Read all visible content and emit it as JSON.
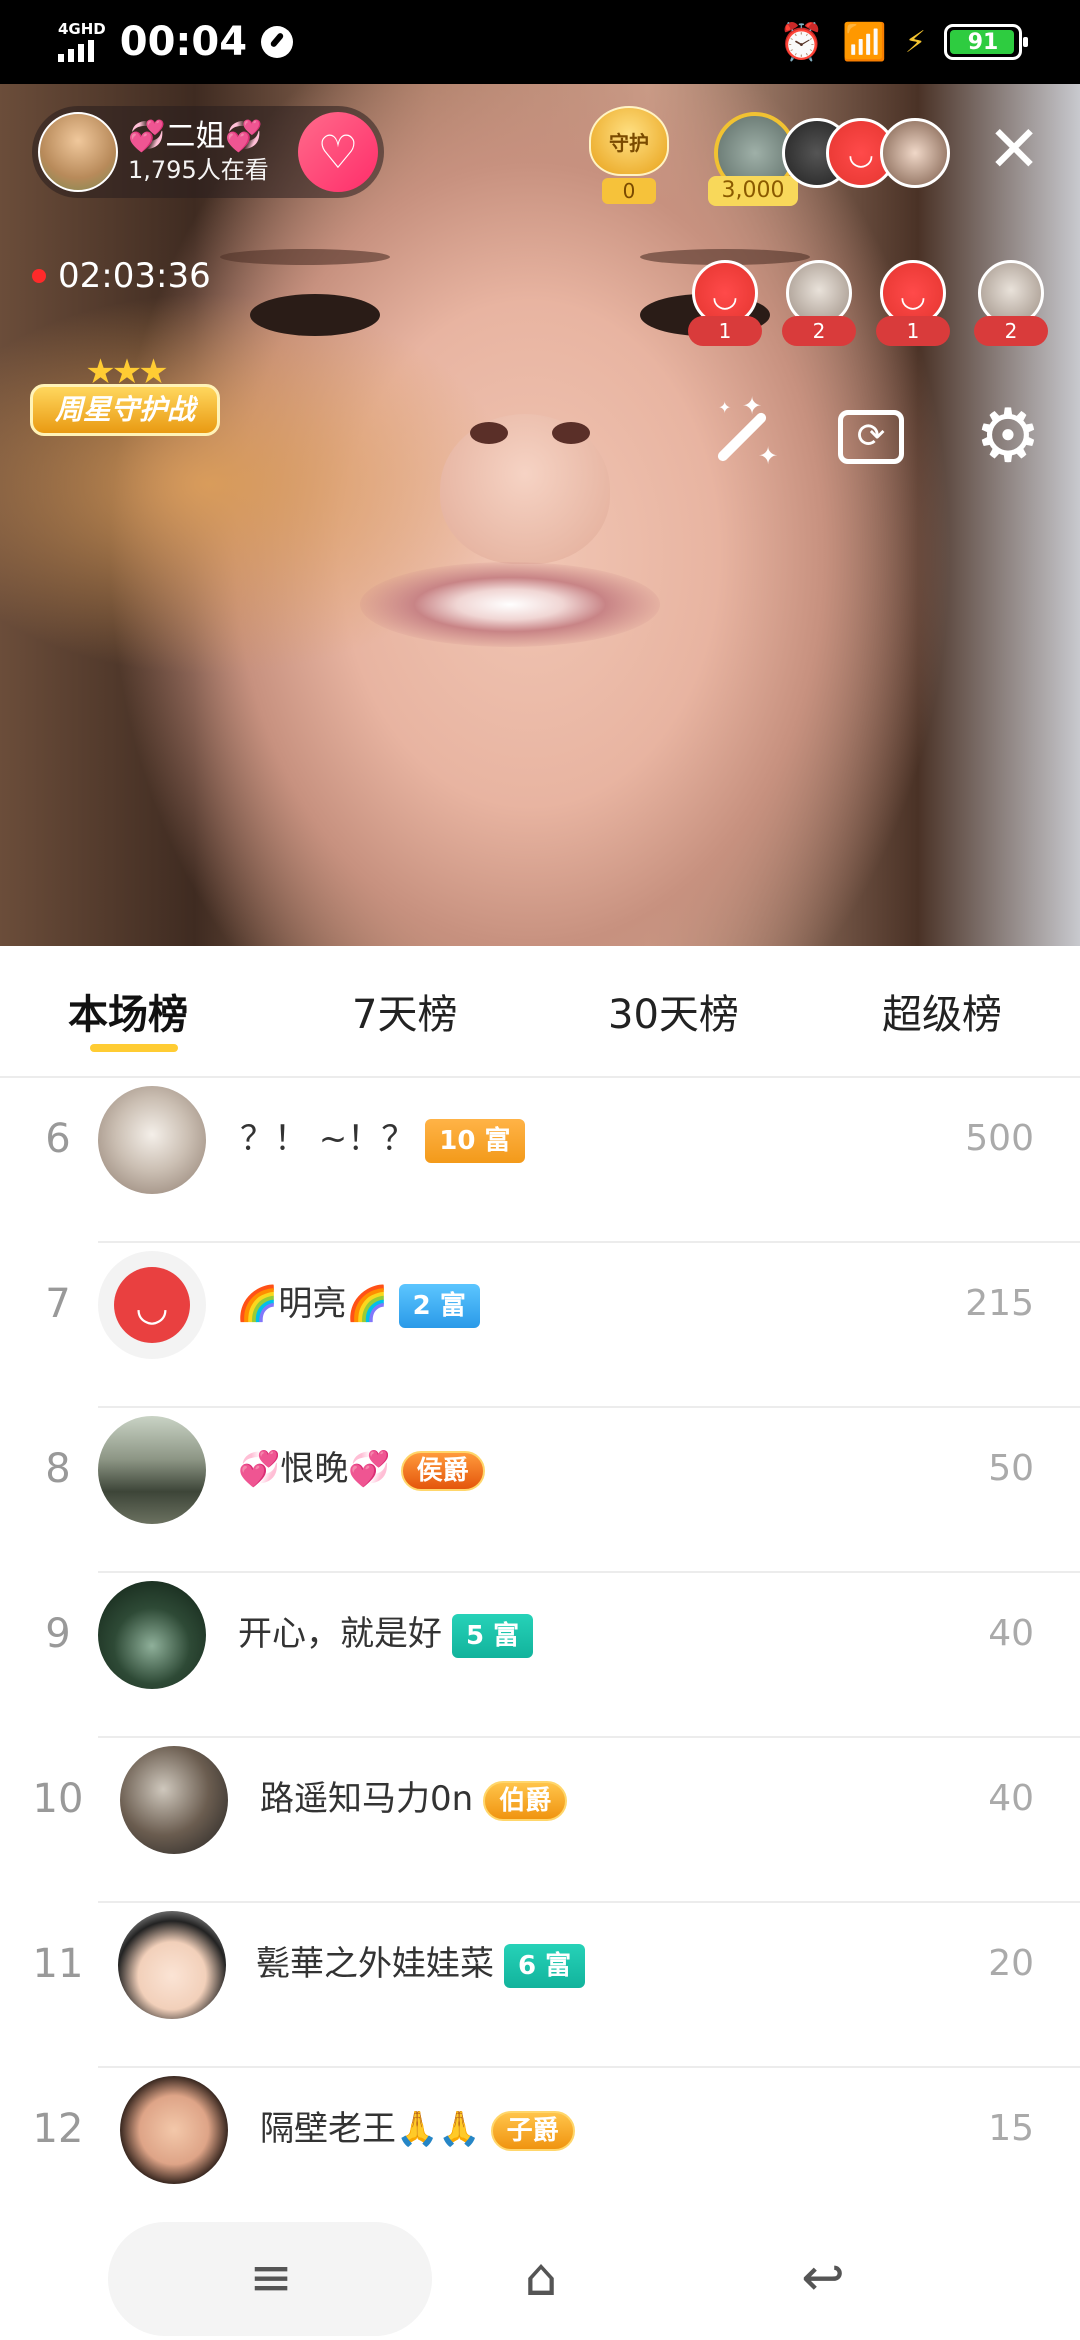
{
  "status_bar": {
    "network": "4GHD",
    "time": "00:04",
    "battery": "91",
    "icons": [
      "signal-icon",
      "compass-icon",
      "alarm-icon",
      "wifi-icon",
      "charging-icon",
      "battery-icon"
    ]
  },
  "live": {
    "host_name": "💞二姐💞",
    "viewers": "1,795人在看",
    "follow_icon": "heart-plus-icon",
    "guard_label": "守护",
    "guard_count": "0",
    "top_fan_value": "3,000",
    "timer": "02:03:36",
    "weekstar_label": "周星守护战",
    "gift_counts": [
      "1",
      "2",
      "1",
      "2"
    ]
  },
  "tabs": [
    {
      "label": "本场榜",
      "active": true
    },
    {
      "label": "7天榜",
      "active": false
    },
    {
      "label": "30天榜",
      "active": false
    },
    {
      "label": "超级榜",
      "active": false
    }
  ],
  "leaderboard": [
    {
      "rank": "6",
      "name": "？！ ~！？",
      "badge": "10 富",
      "score": "500"
    },
    {
      "rank": "7",
      "name": "🌈明亮🌈",
      "badge": "2 富",
      "score": "215"
    },
    {
      "rank": "8",
      "name": "💞恨晚💞",
      "badge": "侯爵",
      "score": "50"
    },
    {
      "rank": "9",
      "name": "开心，就是好",
      "badge": "5 富",
      "score": "40"
    },
    {
      "rank": "10",
      "name": "路遥知马力0n",
      "badge": "伯爵",
      "score": "40"
    },
    {
      "rank": "11",
      "name": "甏華之外娃娃菜",
      "badge": "6 富",
      "score": "20"
    },
    {
      "rank": "12",
      "name": "隔壁老王🙏🙏",
      "badge": "子爵",
      "score": "15"
    }
  ],
  "colors": {
    "accent": "#ffcc33",
    "follow": "#ff2d6a",
    "live_dot": "#ff2a2a"
  }
}
